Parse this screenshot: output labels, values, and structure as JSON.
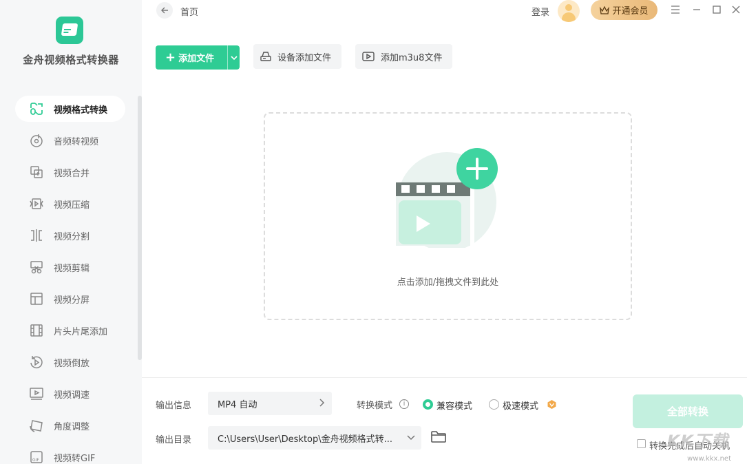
{
  "app": {
    "title": "金舟视频格式转换器"
  },
  "sidebar": {
    "items": [
      {
        "label": "视频格式转换",
        "icon": "video-convert-icon",
        "active": true
      },
      {
        "label": "音频转视频",
        "icon": "audio-disc-icon"
      },
      {
        "label": "视频合并",
        "icon": "merge-icon"
      },
      {
        "label": "视频压缩",
        "icon": "compress-icon"
      },
      {
        "label": "视频分割",
        "icon": "split-icon"
      },
      {
        "label": "视频剪辑",
        "icon": "scissors-icon"
      },
      {
        "label": "视频分屏",
        "icon": "split-screen-icon"
      },
      {
        "label": "片头片尾添加",
        "icon": "film-strip-icon"
      },
      {
        "label": "视频倒放",
        "icon": "reverse-play-icon"
      },
      {
        "label": "视频调速",
        "icon": "speed-screen-icon"
      },
      {
        "label": "角度调整",
        "icon": "angle-icon"
      },
      {
        "label": "视频转GIF",
        "icon": "gif-icon"
      }
    ]
  },
  "header": {
    "breadcrumb": "首页",
    "login": "登录",
    "vip": "开通会员"
  },
  "toolbar": {
    "add_file": "添加文件",
    "device_add": "设备添加文件",
    "add_m3u8": "添加m3u8文件"
  },
  "dropzone": {
    "hint": "点击添加/拖拽文件到此处"
  },
  "bottom": {
    "output_info_label": "输出信息",
    "output_format": "MP4 自动",
    "mode_label": "转换模式",
    "mode_compatible": "兼容模式",
    "mode_fast": "极速模式",
    "output_dir_label": "输出目录",
    "output_dir": "C:\\Users\\User\\Desktop\\金舟视频格式转...",
    "convert_all": "全部转换",
    "shutdown_after": "转换完成后自动关机"
  },
  "watermark": {
    "text": "KK下载",
    "url": "www.kkx.net"
  },
  "colors": {
    "accent": "#2ecc94",
    "accent_light": "#c3f0df",
    "vip_gold": "#e9b878"
  }
}
